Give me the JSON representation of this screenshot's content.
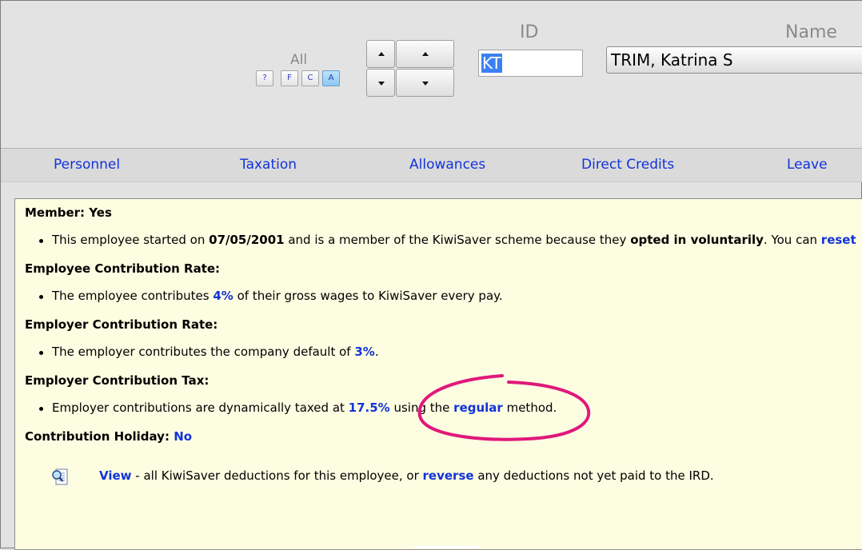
{
  "header": {
    "filter": {
      "label": "All",
      "buttons": [
        {
          "label": "?",
          "active": false
        },
        {
          "label": "F",
          "active": false
        },
        {
          "label": "C",
          "active": false
        },
        {
          "label": "A",
          "active": true
        }
      ]
    },
    "nav_icons": [
      "up-arrow-icon",
      "up-arrow-icon",
      "down-arrow-icon",
      "down-arrow-icon"
    ],
    "id_label": "ID",
    "id_value": "KT",
    "name_label": "Name",
    "name_value": "TRIM, Katrina S"
  },
  "tabs": [
    {
      "label": "Personnel"
    },
    {
      "label": "Taxation"
    },
    {
      "label": "Allowances"
    },
    {
      "label": "Direct Credits"
    },
    {
      "label": "Leave"
    }
  ],
  "kiwisaver": {
    "member": {
      "label": "Member:",
      "value": "Yes"
    },
    "member_line": {
      "pre": "This employee started on ",
      "date": "07/05/2001",
      "mid": " and is a member of the KiwiSaver scheme because they ",
      "reason": "opted in voluntarily",
      "post": ". You can ",
      "link": "reset"
    },
    "employee_rate": {
      "heading": "Employee Contribution Rate:",
      "pre": "The employee contributes ",
      "value": "4%",
      "post": " of their gross wages to KiwiSaver every pay."
    },
    "employer_rate": {
      "heading": "Employer Contribution Rate:",
      "pre": "The employer contributes the company default of ",
      "value": "3%",
      "post": "."
    },
    "employer_tax": {
      "heading": "Employer Contribution Tax:",
      "pre": "Employer contributions are dynamically taxed at ",
      "rate": "17.5%",
      "mid": " using the ",
      "method": "regular",
      "post": " method."
    },
    "holiday": {
      "label": "Contribution Holiday:",
      "value": "No"
    },
    "view_line": {
      "icon": "magnifier-document-icon",
      "view_link": "View",
      "mid": " - all KiwiSaver deductions for this employee, or ",
      "reverse_link": "reverse",
      "post": " any deductions not yet paid to the IRD."
    }
  },
  "colors": {
    "link": "#1233d8",
    "panel_bg": "#fdfde2",
    "annotation": "#e0187a",
    "selection": "#3b80f4"
  }
}
